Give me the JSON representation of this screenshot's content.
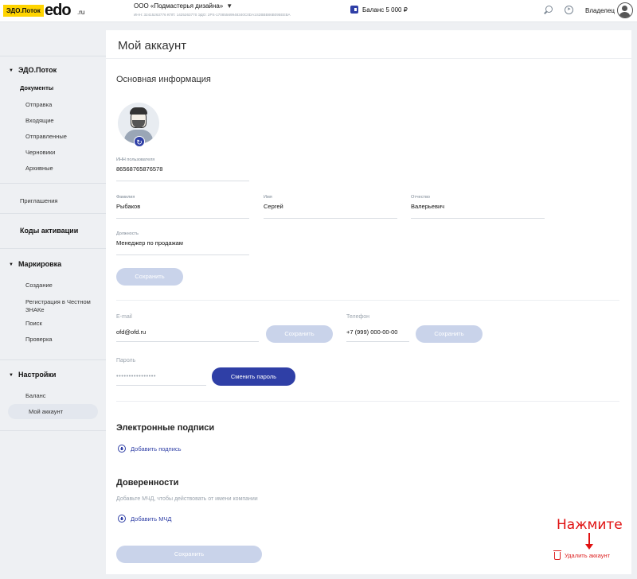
{
  "header": {
    "badge": "ЭДО.Поток",
    "logo": "edo",
    "logo_suffix": ".ru",
    "company": "ООО «Подмастерья дизайна»",
    "company_meta": "ИНН: 32415263776   КПП: 1425263770   ЭДО: 2PS-17085569948340C0DA1S2BBB86B095EEBA",
    "balance": "Баланс 5 000 ₽",
    "owner": "Владелец"
  },
  "sidebar": {
    "section1": "ЭДО.Поток",
    "documents": "Документы",
    "doc_items": [
      "Отправка",
      "Входящие",
      "Отправленные",
      "Черновики",
      "Архивные"
    ],
    "invitations": "Приглашения",
    "activation_codes": "Коды активации",
    "section2": "Маркировка",
    "mark_items": [
      "Создание",
      "Регистрация в Честном ЗНАКе",
      "Поиск",
      "Проверка"
    ],
    "section3": "Настройки",
    "settings_items": [
      "Баланс",
      "Мой аккаунт"
    ]
  },
  "main": {
    "title": "Мой аккаунт",
    "basic_info": "Основная информация",
    "inn_label": "ИНН пользователя",
    "inn_value": "86568765876578",
    "last_name_label": "Фамилия",
    "last_name_value": "Рыбаков",
    "first_name_label": "Имя",
    "first_name_value": "Сергей",
    "middle_name_label": "Отчество",
    "middle_name_value": "Валерьевич",
    "position_label": "Должность",
    "position_value": "Менеджер по продажам",
    "save": "Сохранить",
    "email_label": "E-mail",
    "email_value": "ofd@ofd.ru",
    "phone_label": "Телефон",
    "phone_value": "+7 (999) 000-00-00",
    "password_label": "Пароль",
    "password_value": "••••••••••••••••",
    "change_password": "Сменить пароль",
    "signatures": "Электронные подписи",
    "add_signature": "Добавить подпись",
    "poa": "Доверенности",
    "poa_hint": "Добавьте МЧД, чтобы действовать от имени компании",
    "add_mchd": "Добавить МЧД",
    "delete_account": "Удалить аккаунт"
  },
  "annotation": "Нажмите",
  "colors": {
    "primary": "#2f3fa6",
    "disabled": "#c9d3ea",
    "danger": "#dd2222",
    "annotation": "#e01010"
  }
}
